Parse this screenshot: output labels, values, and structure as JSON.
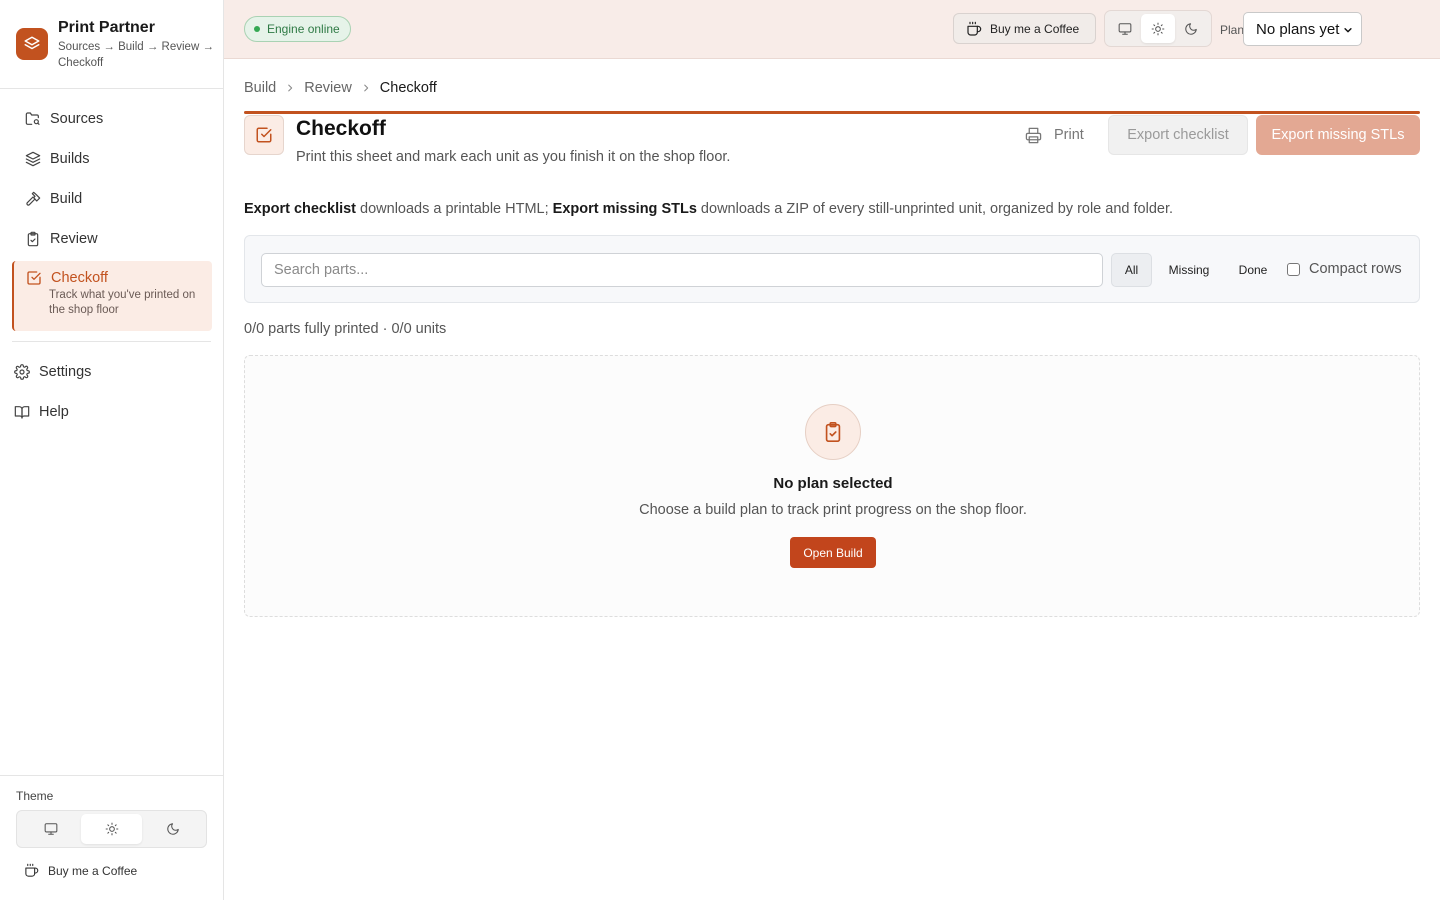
{
  "app": {
    "name": "Print Partner",
    "flow": "Sources → Build → Review → Checkoff"
  },
  "sidebar": {
    "items": [
      {
        "label": "Sources",
        "icon": "folder-search-icon"
      },
      {
        "label": "Builds",
        "icon": "layers-icon"
      },
      {
        "label": "Build",
        "icon": "hammer-icon"
      },
      {
        "label": "Review",
        "icon": "clipboard-icon"
      },
      {
        "label": "Checkoff",
        "icon": "check-square-icon",
        "description": "Track what you've printed on the shop floor",
        "active": true
      }
    ],
    "secondary": [
      {
        "label": "Settings",
        "icon": "gear-icon"
      },
      {
        "label": "Help",
        "icon": "book-icon"
      }
    ],
    "theme_label": "Theme",
    "coffee_label": "Buy me a Coffee"
  },
  "topbar": {
    "engine_status": "Engine online",
    "coffee_label": "Buy me a Coffee",
    "plan_label": "Plan",
    "plan_value": "No plans yet"
  },
  "breadcrumb": [
    "Build",
    "Review",
    "Checkoff"
  ],
  "page": {
    "title": "Checkoff",
    "subtitle": "Print this sheet and mark each unit as you finish it on the shop floor.",
    "print_label": "Print",
    "export_checklist_label": "Export checklist",
    "export_missing_label": "Export missing STLs",
    "description": {
      "term1": "Export checklist",
      "text1": " downloads a printable HTML; ",
      "term2": "Export missing STLs",
      "text2": " downloads a ZIP of every still-unprinted unit, organized by role and folder."
    }
  },
  "filters": {
    "search_placeholder": "Search parts...",
    "all": "All",
    "missing": "Missing",
    "done": "Done",
    "compact_label": "Compact rows"
  },
  "progress_text": "0/0 parts fully printed · 0/0 units",
  "empty_state": {
    "title": "No plan selected",
    "subtitle": "Choose a build plan to track print progress on the shop floor.",
    "button": "Open Build"
  },
  "colors": {
    "accent": "#c2521f",
    "accent_soft": "#fbece5",
    "topbar_bg": "#f8ece8",
    "status_green": "#34a853"
  }
}
